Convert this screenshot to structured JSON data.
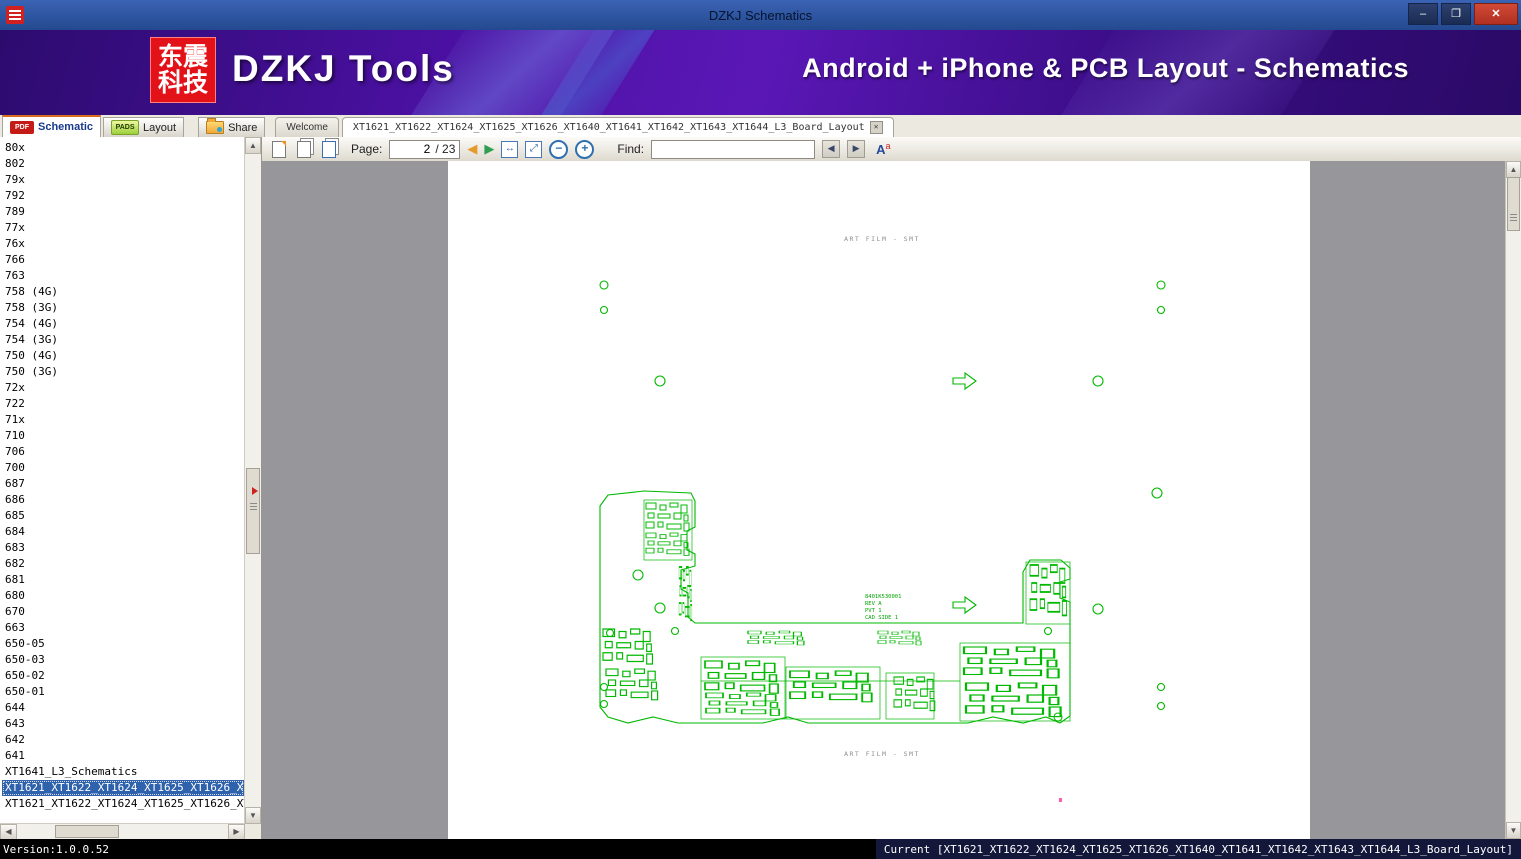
{
  "window": {
    "title": "DZKJ Schematics"
  },
  "banner": {
    "logo_line1": "东震",
    "logo_line2": "科技",
    "app_name": "DZKJ Tools",
    "tagline": "Android + iPhone & PCB Layout - Schematics"
  },
  "tabs": {
    "mode": [
      {
        "label": "Schematic",
        "icon_text": "PDF"
      },
      {
        "label": "Layout",
        "icon_text": "PADS"
      },
      {
        "label": "Share"
      }
    ],
    "docs": [
      {
        "label": "Welcome"
      },
      {
        "label": "XT1621_XT1622_XT1624_XT1625_XT1626_XT1640_XT1641_XT1642_XT1643_XT1644_L3_Board_Layout"
      }
    ]
  },
  "toolbar": {
    "page_label": "Page:",
    "page_value": "2",
    "page_total": "/ 23",
    "find_label": "Find:",
    "find_value": ""
  },
  "sidebar": {
    "items": [
      "80x",
      "802",
      "79x",
      "792",
      "789",
      "77x",
      "76x",
      "766",
      "763",
      "758 (4G)",
      "758 (3G)",
      "754 (4G)",
      "754 (3G)",
      "750 (4G)",
      "750 (3G)",
      "72x",
      "722",
      "71x",
      "710",
      "706",
      "700",
      "687",
      "686",
      "685",
      "684",
      "683",
      "682",
      "681",
      "680",
      "670",
      "663",
      "650-05",
      "650-03",
      "650-02",
      "650-01",
      "644",
      "643",
      "642",
      "641",
      "XT1641_L3_Schematics",
      "XT1621_XT1622_XT1624_XT1625_XT1626_XT1",
      "XT1621_XT1622_XT1624_XT1625_XT1626_XT1"
    ],
    "selected_index": 40
  },
  "document": {
    "header_text": "ART FILM - SMT",
    "footer_text": "ART FILM - SMT",
    "board_label": [
      "8401K530001",
      "REV A",
      "PVT 1",
      "CAD SIDE 1"
    ]
  },
  "statusbar": {
    "version": "Version:1.0.0.52",
    "current": "Current [XT1621_XT1622_XT1624_XT1625_XT1626_XT1640_XT1641_XT1642_XT1643_XT1644_L3_Board_Layout]"
  },
  "icons": {
    "minimize": "–",
    "maximize": "❐",
    "close": "✕",
    "prev_page": "◀",
    "next_page": "▶",
    "fit_width": "↔",
    "fit_page": "⤢",
    "zoom_out": "−",
    "zoom_in": "+",
    "find_prev": "◀",
    "find_next": "▶",
    "font_main": "A",
    "font_sup": "a",
    "close_tab": "✕",
    "up": "▲",
    "down": "▼",
    "left": "◀",
    "right": "▶"
  },
  "colors": {
    "pcb_green": "#00b800",
    "selection_blue": "#2f62ad",
    "banner_purple": "#4a10a0",
    "titlebar_blue": "#2a4f9e",
    "close_red": "#b03022"
  }
}
